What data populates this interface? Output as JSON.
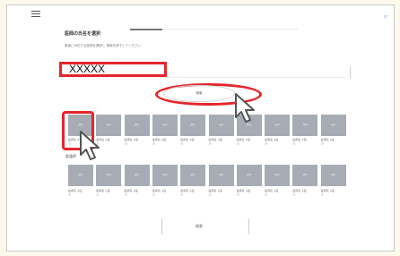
{
  "header": {
    "top_right": "ﾛｸﾞ"
  },
  "page": {
    "title": "医師の氏名を選択",
    "instruction": "患者に対応する医師を選択し 検索を押下してください"
  },
  "name_field": {
    "value": "XXXXX"
  },
  "search_button": {
    "label": "検索"
  },
  "row1": {
    "thumb_label": "医師",
    "items": [
      {
        "caption": [
          "医師名  ※名",
          "ふ"
        ]
      },
      {
        "caption": [
          "医師名 ※医",
          "ふ"
        ]
      },
      {
        "caption": [
          "医師名 ※医",
          "ふ"
        ]
      },
      {
        "caption": [
          "医師名 ※医",
          "ふ"
        ]
      },
      {
        "caption": [
          "医師名 ※医",
          "ふ"
        ]
      },
      {
        "caption": [
          "医師名 ※医",
          "ふ"
        ]
      },
      {
        "caption": [
          "医師名 ※医",
          "ふ"
        ]
      },
      {
        "caption": [
          "医師名 ※医",
          "ふ"
        ]
      },
      {
        "caption": [
          "医師名 ※医",
          "ふ"
        ]
      },
      {
        "caption": [
          "医師名 ※医",
          "ふ"
        ]
      }
    ]
  },
  "row2": {
    "heading": "看護師",
    "thumb_label": "医師",
    "items": [
      {
        "caption": [
          "医師名 ※医",
          "ふ"
        ]
      },
      {
        "caption": [
          "医師名 ※医",
          "ふ"
        ]
      },
      {
        "caption": [
          "医師名 ※医",
          "ふ"
        ]
      },
      {
        "caption": [
          "医師名 ※医",
          "ふ"
        ]
      },
      {
        "caption": [
          "医師名 ※医",
          "ふ"
        ]
      },
      {
        "caption": [
          "医師名 ※医",
          "ふ"
        ]
      },
      {
        "caption": [
          "医師名 ※医",
          "ふ"
        ]
      },
      {
        "caption": [
          "医師名 ※医",
          "ふ"
        ]
      },
      {
        "caption": [
          "医師名 ※医",
          "ふ"
        ]
      },
      {
        "caption": [
          "医師名 ※医",
          "ふ"
        ]
      }
    ]
  },
  "pagination": {
    "label": "検索"
  },
  "colors": {
    "highlight": "#e5252c",
    "thumb": "#a7acb4",
    "background": "#fcf8ee"
  }
}
